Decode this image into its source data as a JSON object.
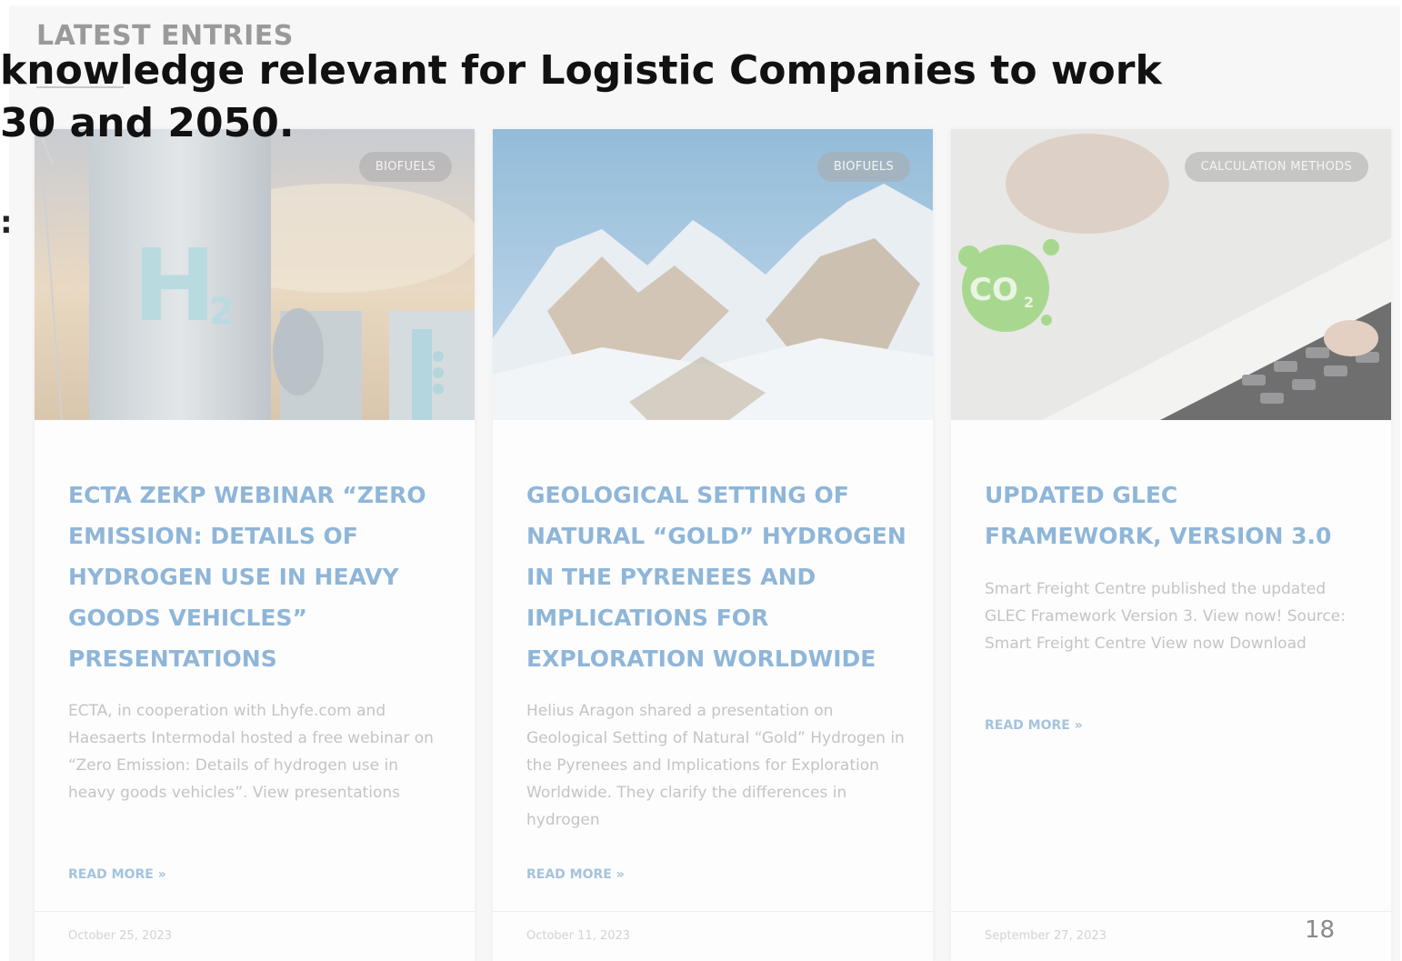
{
  "section": {
    "title": "LATEST ENTRIES"
  },
  "overlay": {
    "line1": "knowledge relevant for Logistic Companies to work",
    "line2": "30 and 2050.",
    "fragment": ":"
  },
  "cards": [
    {
      "category": "BIOFUELS",
      "title": "ECTA ZEKP WEBINAR “ZERO EMISSION: DETAILS OF HYDROGEN USE IN HEAVY GOODS VEHICLES” PRESENTATIONS",
      "excerpt": "ECTA, in cooperation with Lhyfe.com and Haesaerts Intermodal hosted a free webinar on “Zero Emission: Details of hydrogen use in heavy goods vehicles”. View presentations",
      "read_more": "READ MORE »",
      "date": "October 25, 2023",
      "image_icon": "hydrogen-tank-image"
    },
    {
      "category": "BIOFUELS",
      "title": "GEOLOGICAL SETTING OF NATURAL “GOLD” HYDROGEN IN THE PYRENEES AND IMPLICATIONS FOR EXPLORATION WORLDWIDE",
      "excerpt": "Helius Aragon shared a presentation on Geological Setting of Natural “Gold” Hydrogen in the Pyrenees and Implications for Exploration Worldwide. They clarify the differences in hydrogen",
      "read_more": "READ MORE »",
      "date": "October 11, 2023",
      "image_icon": "snowy-mountains-image"
    },
    {
      "category": "CALCULATION METHODS",
      "title": "UPDATED GLEC FRAMEWORK, VERSION 3.0",
      "excerpt": "Smart Freight Centre published the updated GLEC Framework Version 3. View now! Source: Smart Freight Centre View now Download",
      "read_more": "READ MORE »",
      "date": "September 27, 2023",
      "image_icon": "co2-calculator-image"
    }
  ],
  "image_text": {
    "h2": "H",
    "h2_sub": "2",
    "co2": "CO",
    "co2_sub": "2"
  },
  "page_number": "18",
  "colors": {
    "title": "#8fb6d8",
    "excerpt": "#c4c4c4",
    "read_more": "#a5c3de",
    "overlay": "#111111"
  }
}
